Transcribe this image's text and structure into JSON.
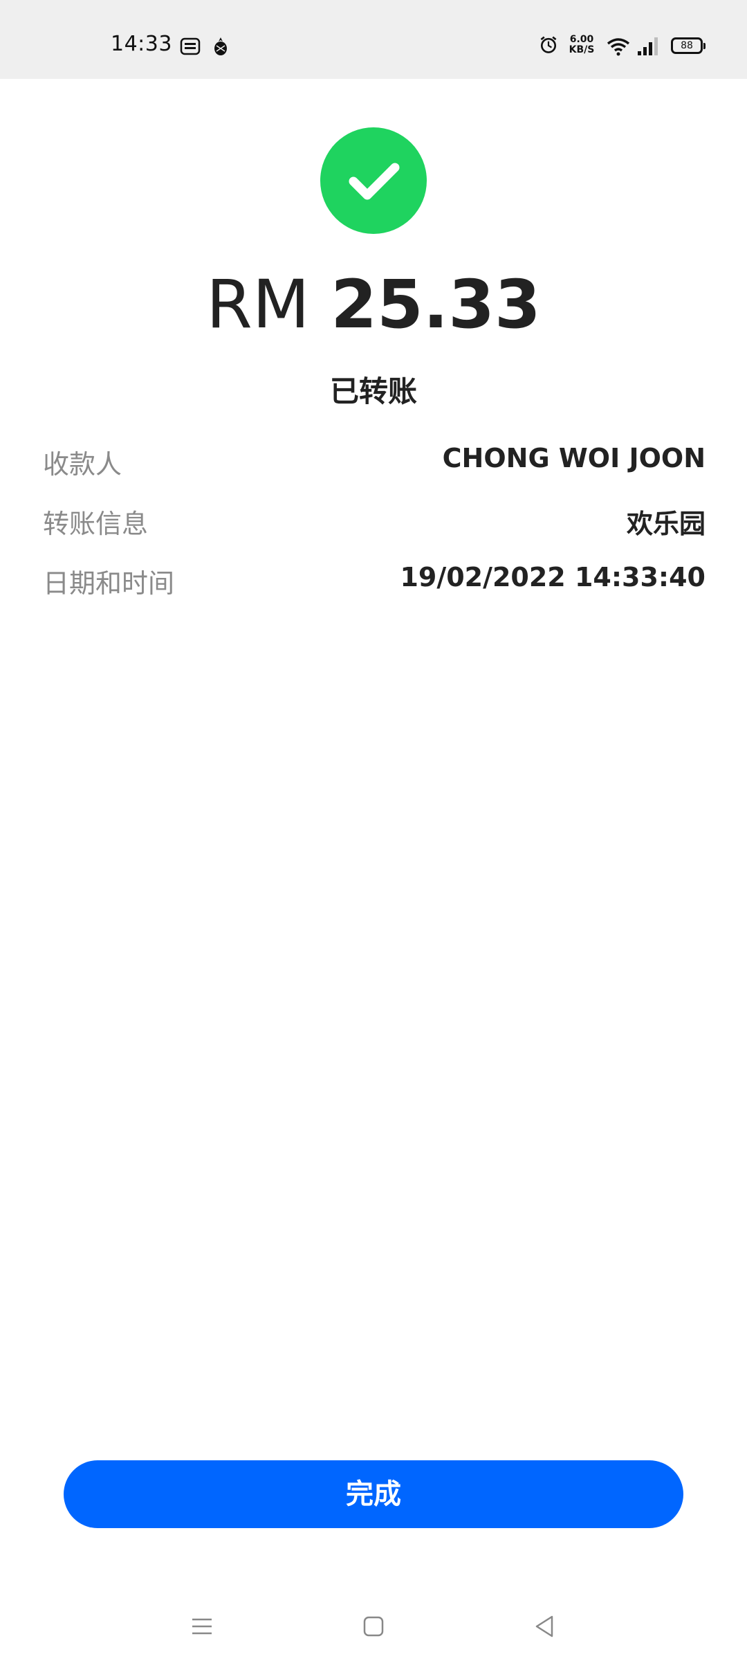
{
  "status_bar": {
    "time": "14:33",
    "notification_icons": [
      "touch-n-go-icon",
      "pineapple-icon"
    ],
    "alarm_icon": "alarm-clock-icon",
    "net_speed_value": "6.00",
    "net_speed_unit": "KB/S",
    "wifi_icon": "wifi-icon",
    "signal_icon": "cellular-signal-icon",
    "battery_level": "88"
  },
  "receipt": {
    "success_icon": "check-circle-icon",
    "success_color": "#1fd35f",
    "currency": "RM",
    "amount": "25.33",
    "status_text": "已转账",
    "details": [
      {
        "label": "收款人",
        "value": "CHONG WOI JOON"
      },
      {
        "label": "转账信息",
        "value": "欢乐园"
      },
      {
        "label": "日期和时间",
        "value": "19/02/2022 14:33:40"
      }
    ]
  },
  "actions": {
    "done_label": "完成",
    "done_color": "#0066ff"
  },
  "nav_bar": {
    "menu_icon": "menu-icon",
    "home_icon": "home-square-icon",
    "back_icon": "back-triangle-icon"
  }
}
